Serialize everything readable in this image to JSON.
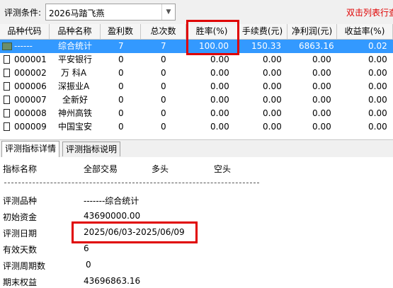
{
  "filter": {
    "label": "评测条件:",
    "selected": "2026马踏飞燕",
    "hint": "双击列表行查"
  },
  "table": {
    "columns": [
      "品种代码",
      "品种名称",
      "盈利数",
      "总次数",
      "胜率(%)",
      "手续费(元)",
      "净利润(元)",
      "收益率(%)"
    ],
    "rows": [
      {
        "code": "------",
        "name": "综合统计",
        "win": "7",
        "total": "7",
        "rate": "100.00",
        "fee": "150.33",
        "profit": "6863.16",
        "ret": "0.02",
        "selected": true
      },
      {
        "code": "000001",
        "name": "平安银行",
        "win": "0",
        "total": "0",
        "rate": "0.00",
        "fee": "0.00",
        "profit": "0.00",
        "ret": "0.00"
      },
      {
        "code": "000002",
        "name": "万 科A",
        "win": "0",
        "total": "0",
        "rate": "0.00",
        "fee": "0.00",
        "profit": "0.00",
        "ret": "0.00"
      },
      {
        "code": "000006",
        "name": "深振业A",
        "win": "0",
        "total": "0",
        "rate": "0.00",
        "fee": "0.00",
        "profit": "0.00",
        "ret": "0.00"
      },
      {
        "code": "000007",
        "name": "全新好",
        "win": "0",
        "total": "0",
        "rate": "0.00",
        "fee": "0.00",
        "profit": "0.00",
        "ret": "0.00"
      },
      {
        "code": "000008",
        "name": "神州高铁",
        "win": "0",
        "total": "0",
        "rate": "0.00",
        "fee": "0.00",
        "profit": "0.00",
        "ret": "0.00"
      },
      {
        "code": "000009",
        "name": "中国宝安",
        "win": "0",
        "total": "0",
        "rate": "0.00",
        "fee": "0.00",
        "profit": "0.00",
        "ret": "0.00"
      }
    ]
  },
  "tabs": [
    "评测指标详情",
    "评测指标说明"
  ],
  "detail": {
    "headers": [
      "指标名称",
      "全部交易",
      "多头",
      "空头"
    ],
    "items": [
      {
        "label": "评测品种",
        "value": "-------综合统计"
      },
      {
        "label": "初始资金",
        "value": "43690000.00"
      },
      {
        "label": "评测日期",
        "value": "2025/06/03-2025/06/09"
      },
      {
        "label": "有效天数",
        "value": "6"
      },
      {
        "label": "评测周期数",
        "value": "0"
      },
      {
        "label": "期末权益",
        "value": "43696863.16"
      }
    ]
  },
  "colors": {
    "highlight": "#e00000",
    "selection": "#3399ff"
  }
}
